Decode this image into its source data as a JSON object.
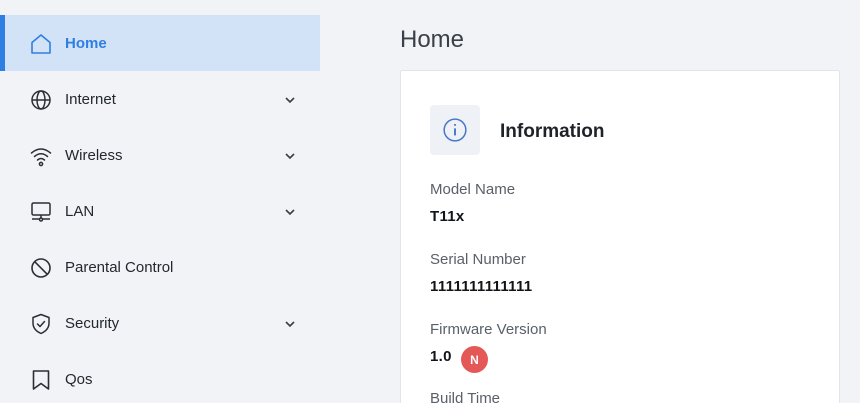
{
  "sidebar": {
    "items": [
      {
        "label": "Home",
        "icon": "home-icon",
        "active": true,
        "has_submenu": false
      },
      {
        "label": "Internet",
        "icon": "globe-icon",
        "active": false,
        "has_submenu": true
      },
      {
        "label": "Wireless",
        "icon": "wifi-icon",
        "active": false,
        "has_submenu": true
      },
      {
        "label": "LAN",
        "icon": "lan-icon",
        "active": false,
        "has_submenu": true
      },
      {
        "label": "Parental Control",
        "icon": "block-icon",
        "active": false,
        "has_submenu": false
      },
      {
        "label": "Security",
        "icon": "shield-check-icon",
        "active": false,
        "has_submenu": true
      },
      {
        "label": "Qos",
        "icon": "bookmark-icon",
        "active": false,
        "has_submenu": false
      }
    ]
  },
  "main": {
    "title": "Home",
    "card": {
      "title": "Information",
      "icon": "info-icon",
      "fields": [
        {
          "label": "Model Name",
          "value": "T11x"
        },
        {
          "label": "Serial Number",
          "value": "1111111111111"
        },
        {
          "label": "Firmware Version",
          "value": "1.0",
          "badge": "N"
        },
        {
          "label": "Build Time",
          "value": ""
        }
      ]
    }
  },
  "colors": {
    "accent": "#2f7fe2",
    "active_bg": "#d3e3f7",
    "badge": "#e45858",
    "background": "#f1f3f6"
  }
}
